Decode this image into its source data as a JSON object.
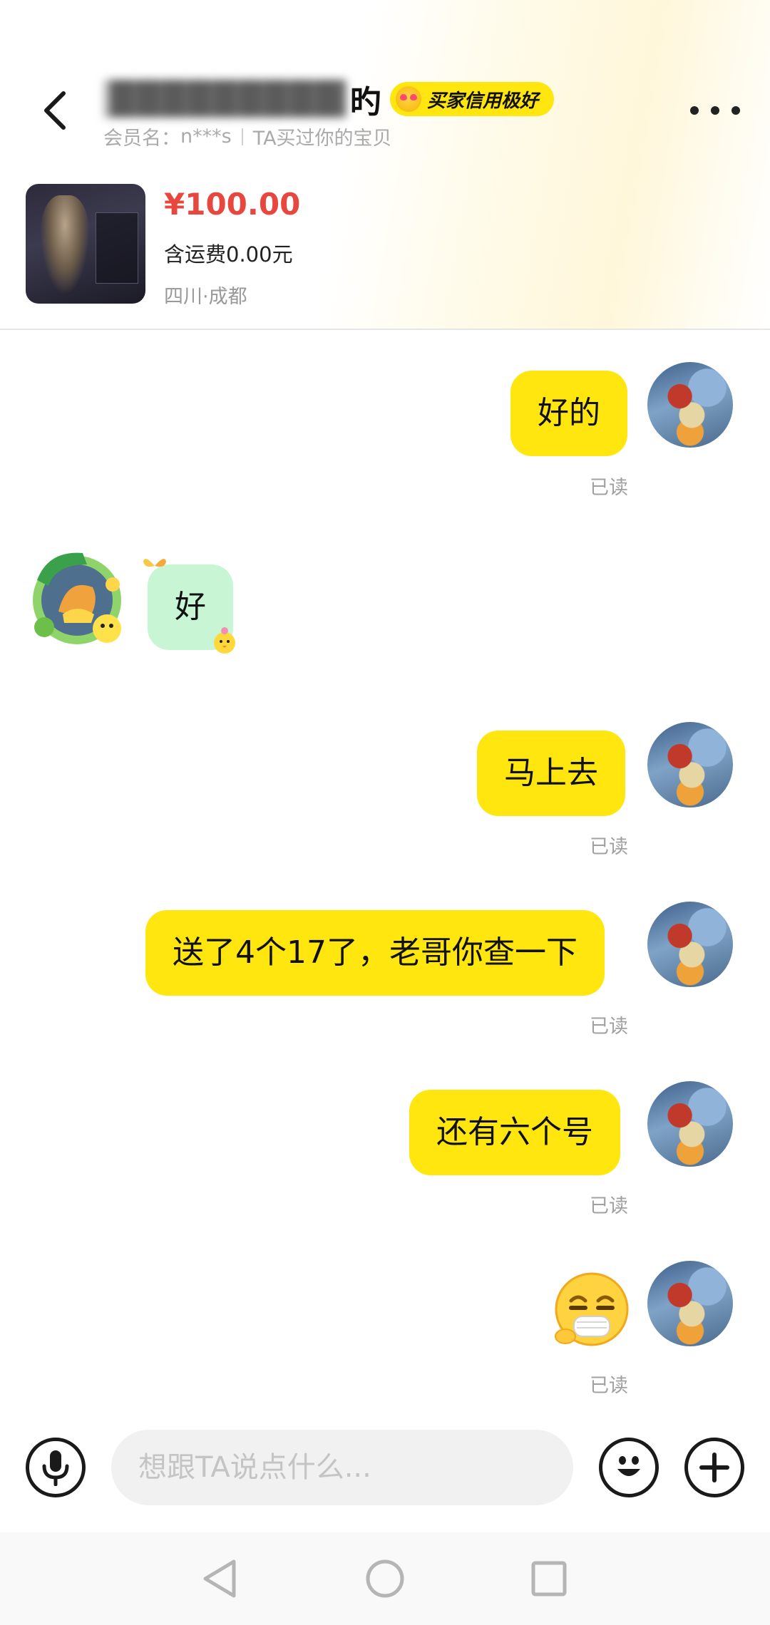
{
  "header": {
    "title_name": "██████████",
    "title_tail": "旳",
    "credit_badge": "买家信用极好",
    "member_prefix": "会员名：",
    "member_name": "n***s",
    "member_note": "TA买过你的宝贝",
    "icons": {
      "back": "back-chevron-icon",
      "more": "more-dots-icon"
    }
  },
  "product": {
    "price": "¥100.00",
    "shipping": "含运费0.00元",
    "location": "四川·成都"
  },
  "messages": [
    {
      "from": "me",
      "text": "好的",
      "status": "已读"
    },
    {
      "from": "other",
      "text": "好"
    },
    {
      "from": "me",
      "text": "马上去",
      "status": "已读"
    },
    {
      "from": "me",
      "text": "送了4个17了，老哥你查一下",
      "status": "已读"
    },
    {
      "from": "me",
      "text": "还有六个号",
      "status": "已读"
    },
    {
      "from": "me",
      "emoji": "smile-with-mask-emoji",
      "status": "已读"
    }
  ],
  "input_bar": {
    "placeholder": "想跟TA说点什么...",
    "value": "",
    "icons": {
      "voice": "microphone-icon",
      "emoji": "smiley-icon",
      "more": "plus-icon"
    }
  },
  "colors": {
    "bubble_me": "#ffe60f",
    "bubble_other": "#c8f5d4",
    "price": "#e8473f",
    "badge": "#ffe60f"
  }
}
